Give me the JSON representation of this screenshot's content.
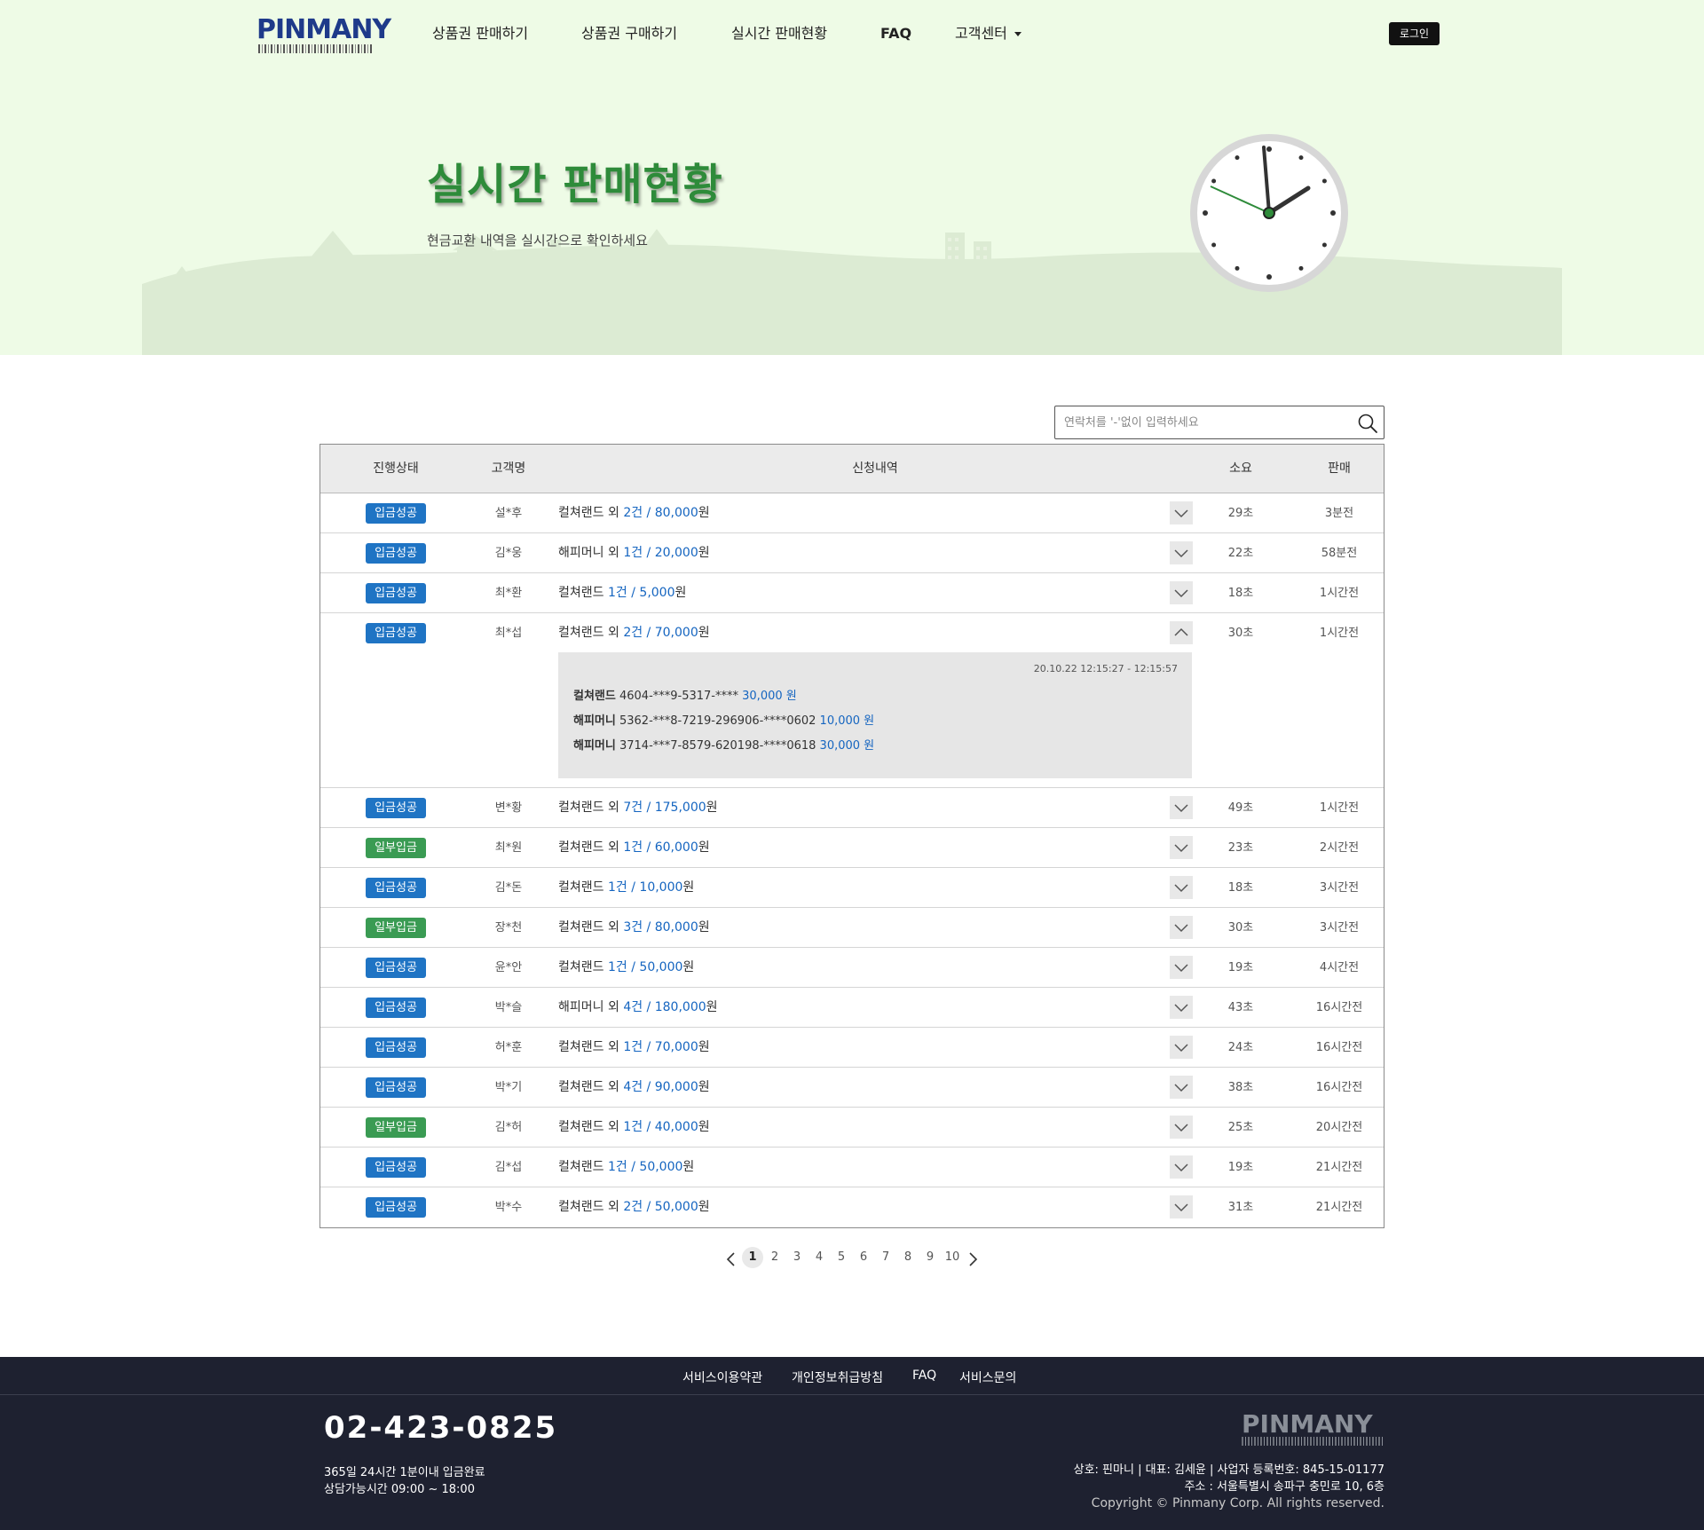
{
  "nav": {
    "logo": "PINMANY",
    "items": [
      "상품권 판매하기",
      "상품권 구매하기",
      "실시간 판매현황",
      "FAQ",
      "고객센터"
    ],
    "login": "로그인"
  },
  "hero": {
    "title": "실시간 판매현황",
    "subtitle": "현금교환 내역을 실시간으로 확인하세요"
  },
  "search": {
    "placeholder": "연락처를 '-'없이 입력하세요"
  },
  "table": {
    "headers": [
      "진행상태",
      "고객명",
      "신청내역",
      "소요",
      "판매"
    ],
    "rows": [
      {
        "status": "입금성공",
        "status_color": "#1f74c4",
        "name": "설*후",
        "item": "컬쳐랜드 외 ",
        "count": "2건",
        "sep": " / ",
        "amount": "80,000",
        "unit": "원",
        "duration": "29초",
        "ago": "3분전",
        "expanded": false
      },
      {
        "status": "입금성공",
        "status_color": "#1f74c4",
        "name": "김*웅",
        "item": "해피머니 외 ",
        "count": "1건",
        "sep": " / ",
        "amount": "20,000",
        "unit": "원",
        "duration": "22초",
        "ago": "58분전",
        "expanded": false
      },
      {
        "status": "입금성공",
        "status_color": "#1f74c4",
        "name": "최*환",
        "item": "컬쳐랜드 ",
        "count": "1건",
        "sep": " / ",
        "amount": "5,000",
        "unit": "원",
        "duration": "18초",
        "ago": "1시간전",
        "expanded": false
      },
      {
        "status": "입금성공",
        "status_color": "#1f74c4",
        "name": "최*섭",
        "item": "컬쳐랜드 외 ",
        "count": "2건",
        "sep": " / ",
        "amount": "70,000",
        "unit": "원",
        "duration": "30초",
        "ago": "1시간전",
        "expanded": true
      },
      {
        "status": "입금성공",
        "status_color": "#1f74c4",
        "name": "변*황",
        "item": "컬쳐랜드 외 ",
        "count": "7건",
        "sep": " / ",
        "amount": "175,000",
        "unit": "원",
        "duration": "49초",
        "ago": "1시간전",
        "expanded": false
      },
      {
        "status": "일부입금",
        "status_color": "#3a9b53",
        "name": "최*원",
        "item": "컬쳐랜드 외 ",
        "count": "1건",
        "sep": " / ",
        "amount": "60,000",
        "unit": "원",
        "duration": "23초",
        "ago": "2시간전",
        "expanded": false
      },
      {
        "status": "입금성공",
        "status_color": "#1f74c4",
        "name": "김*돈",
        "item": "컬쳐랜드 ",
        "count": "1건",
        "sep": " / ",
        "amount": "10,000",
        "unit": "원",
        "duration": "18초",
        "ago": "3시간전",
        "expanded": false
      },
      {
        "status": "일부입금",
        "status_color": "#3a9b53",
        "name": "장*천",
        "item": "컬쳐랜드 외 ",
        "count": "3건",
        "sep": " / ",
        "amount": "80,000",
        "unit": "원",
        "duration": "30초",
        "ago": "3시간전",
        "expanded": false
      },
      {
        "status": "입금성공",
        "status_color": "#1f74c4",
        "name": "윤*안",
        "item": "컬쳐랜드 ",
        "count": "1건",
        "sep": " / ",
        "amount": "50,000",
        "unit": "원",
        "duration": "19초",
        "ago": "4시간전",
        "expanded": false
      },
      {
        "status": "입금성공",
        "status_color": "#1f74c4",
        "name": "박*슬",
        "item": "해피머니 외 ",
        "count": "4건",
        "sep": " / ",
        "amount": "180,000",
        "unit": "원",
        "duration": "43초",
        "ago": "16시간전",
        "expanded": false
      },
      {
        "status": "입금성공",
        "status_color": "#1f74c4",
        "name": "허*훈",
        "item": "컬쳐랜드 외 ",
        "count": "1건",
        "sep": " / ",
        "amount": "70,000",
        "unit": "원",
        "duration": "24초",
        "ago": "16시간전",
        "expanded": false
      },
      {
        "status": "입금성공",
        "status_color": "#1f74c4",
        "name": "박*기",
        "item": "컬쳐랜드 외 ",
        "count": "4건",
        "sep": " / ",
        "amount": "90,000",
        "unit": "원",
        "duration": "38초",
        "ago": "16시간전",
        "expanded": false
      },
      {
        "status": "일부입금",
        "status_color": "#3a9b53",
        "name": "김*허",
        "item": "컬쳐랜드 외 ",
        "count": "1건",
        "sep": " / ",
        "amount": "40,000",
        "unit": "원",
        "duration": "25초",
        "ago": "20시간전",
        "expanded": false
      },
      {
        "status": "입금성공",
        "status_color": "#1f74c4",
        "name": "김*섭",
        "item": "컬쳐랜드 ",
        "count": "1건",
        "sep": " / ",
        "amount": "50,000",
        "unit": "원",
        "duration": "19초",
        "ago": "21시간전",
        "expanded": false
      },
      {
        "status": "입금성공",
        "status_color": "#1f74c4",
        "name": "박*수",
        "item": "컬쳐랜드 외 ",
        "count": "2건",
        "sep": " / ",
        "amount": "50,000",
        "unit": "원",
        "duration": "31초",
        "ago": "21시간전",
        "expanded": false
      }
    ],
    "detail": {
      "time": "20.10.22 12:15:27 - 12:15:57",
      "lines": [
        {
          "brand": "컬쳐랜드",
          "pin": "4604-***9-5317-****",
          "amount": "30,000 원"
        },
        {
          "brand": "해피머니",
          "pin": "5362-***8-7219-296906-****0602",
          "amount": "10,000 원"
        },
        {
          "brand": "해피머니",
          "pin": "3714-***7-8579-620198-****0618",
          "amount": "30,000 원"
        }
      ]
    }
  },
  "pagination": {
    "pages": [
      "1",
      "2",
      "3",
      "4",
      "5",
      "6",
      "7",
      "8",
      "9",
      "10"
    ],
    "current": "1"
  },
  "footer": {
    "links": [
      "서비스이용약관",
      "개인정보취급방침",
      "FAQ",
      "서비스문의"
    ],
    "phone": "02-423-0825",
    "hours1": "365일 24시간 1분이내 입금완료",
    "hours2": "상담가능시간 09:00 ~ 18:00",
    "logo": "PINMANY",
    "company": "상호: 핀마니 | 대표: 김세윤 | 사업자 등록번호: 845-15-01177",
    "address": "주소 : 서울특별시 송파구 충민로 10, 6층",
    "copyright": "Copyright © Pinmany Corp. All rights reserved."
  },
  "colors": {
    "hero_bg": "#eefbe6",
    "accent_green": "#2e8b3a",
    "status_success": "#1f74c4",
    "status_partial": "#3a9b53",
    "amount_blue": "#1565c0",
    "footer_bg": "#1e2130"
  }
}
